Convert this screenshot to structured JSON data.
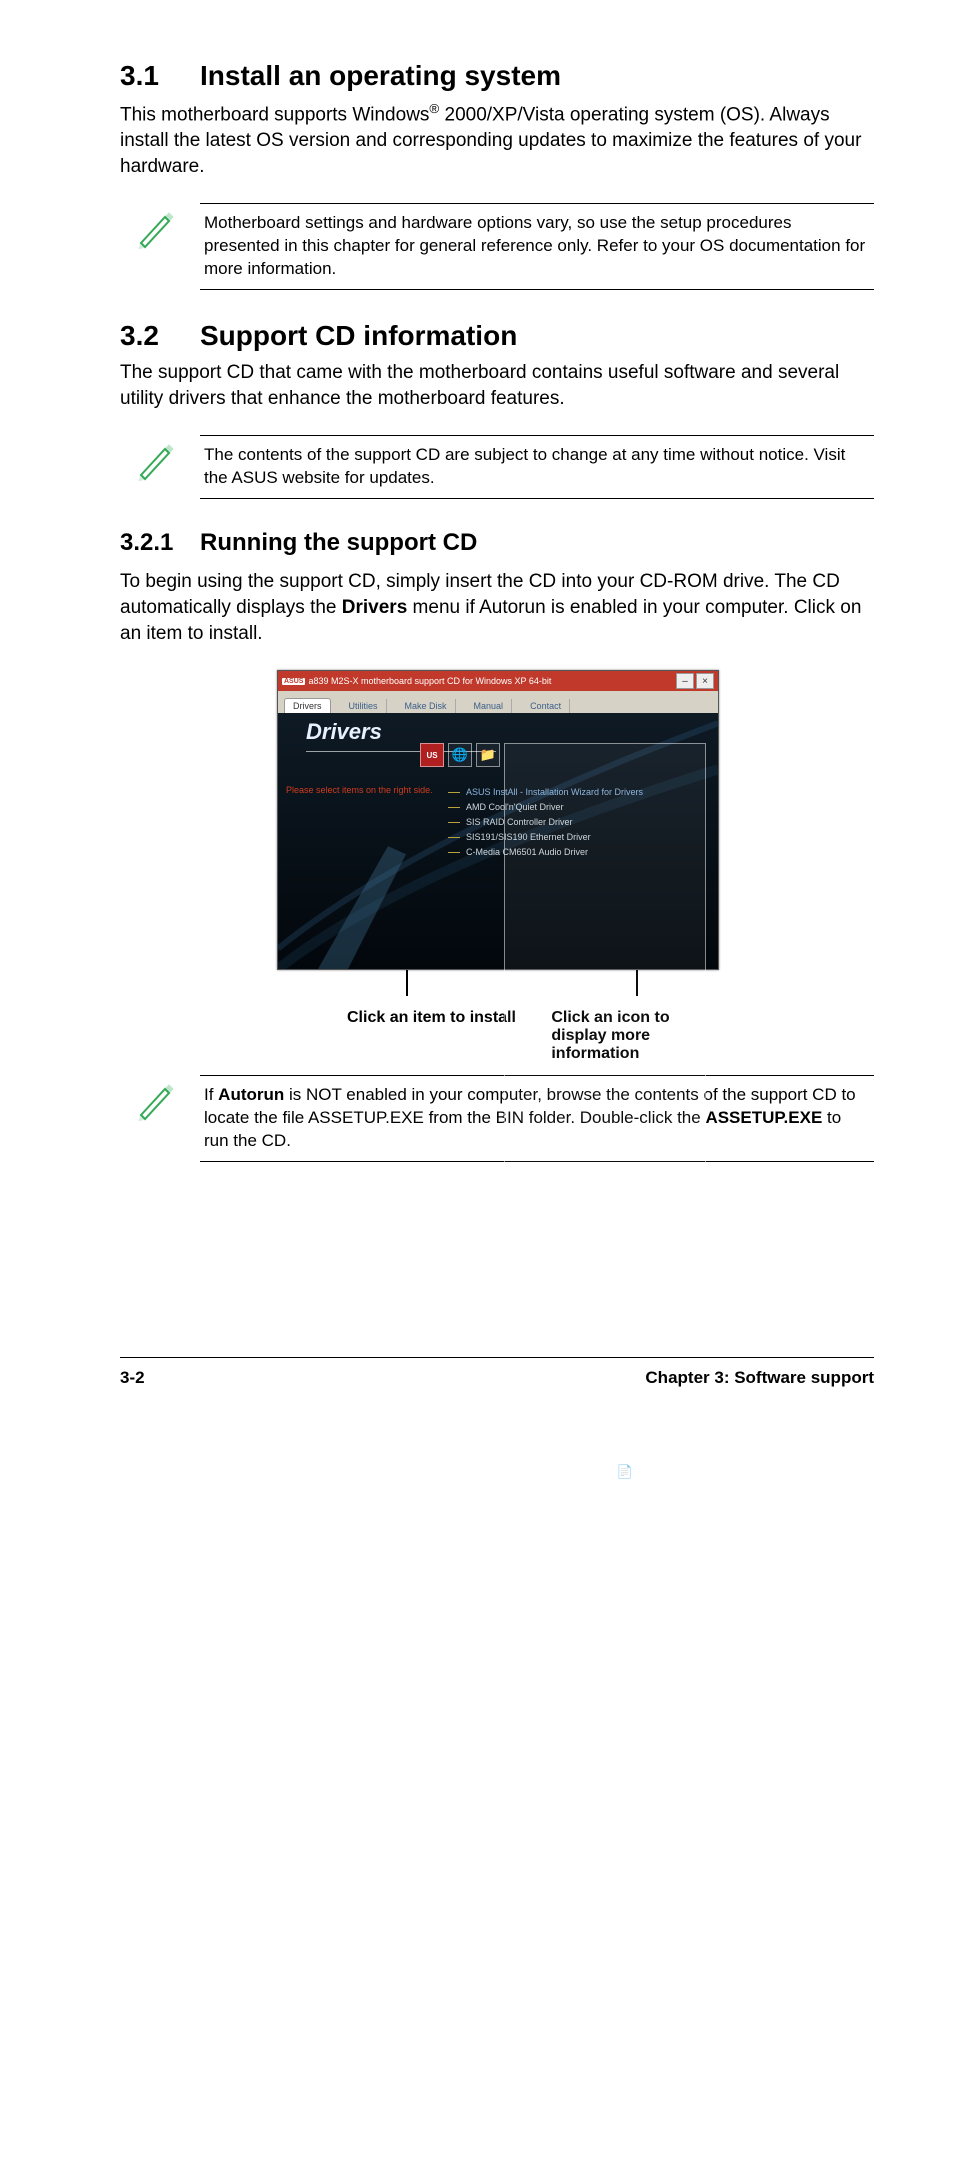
{
  "section31": {
    "num": "3.1",
    "title": "Install an operating system",
    "body_pre": "This motherboard supports Windows",
    "body_sup": "®",
    "body_post": " 2000/XP/Vista operating system (OS). Always install the latest OS version and corresponding updates to maximize the features of your hardware.",
    "note": "Motherboard settings and hardware options vary, so use the setup procedures presented in this chapter for general reference only. Refer to your OS documentation for more information."
  },
  "section32": {
    "num": "3.2",
    "title": "Support CD information",
    "body": "The support CD that came with the motherboard contains useful software and several utility drivers that enhance the motherboard features.",
    "note": "The contents of the support CD are subject to change at any time without notice. Visit the ASUS website for updates."
  },
  "section321": {
    "num": "3.2.1",
    "title": "Running the support CD",
    "body_pre": "To begin using the support CD, simply insert the CD into your CD-ROM drive. The CD automatically displays the ",
    "body_bold": "Drivers",
    "body_post": " menu if Autorun is enabled in your computer. Click on an item to install."
  },
  "app": {
    "asus_badge": "ASUS",
    "title": "a839 M2S-X motherboard support CD for Windows XP 64-bit",
    "tabs": [
      "Drivers",
      "Utilities",
      "Make Disk",
      "Manual",
      "Contact"
    ],
    "banner": "Drivers",
    "side_prompt": "Please select items on the right side.",
    "list": [
      "ASUS InstAll - Installation Wizard for Drivers",
      "AMD Cool'n'Quiet Driver",
      "SIS RAID Controller Driver",
      "SIS191/SIS190 Ethernet Driver",
      "C-Media CM6501 Audio Driver"
    ]
  },
  "callouts": {
    "left": "Click an item to install",
    "right": "Click an icon to display more information"
  },
  "autorun_note": {
    "pre": "If ",
    "b1": "Autorun",
    "mid": " is NOT enabled in your computer, browse the contents of the support CD to locate the file ASSETUP.EXE from the BIN folder. Double-click the ",
    "b2": "ASSETUP.EXE",
    "post": " to run the CD."
  },
  "footer": {
    "left": "3-2",
    "right": "Chapter 3: Software support"
  }
}
